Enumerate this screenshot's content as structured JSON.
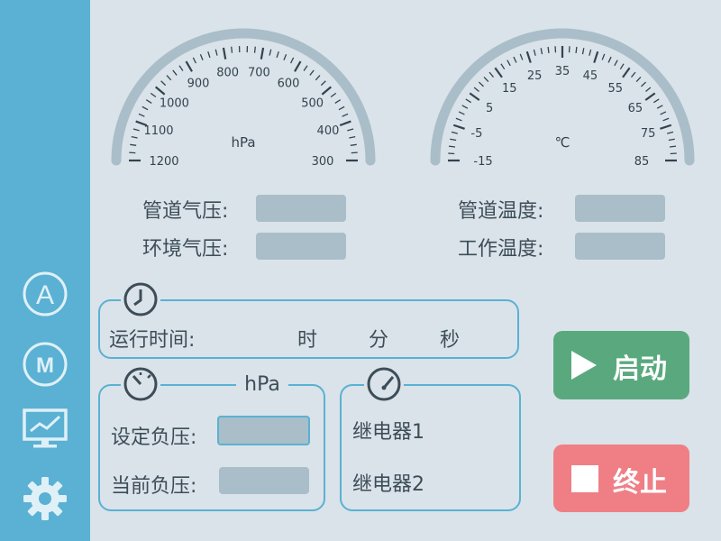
{
  "gauges": {
    "pressure": {
      "unit": "hPa",
      "ticks": [
        "1200",
        "1100",
        "1000",
        "900",
        "800",
        "700",
        "600",
        "500",
        "400",
        "300"
      ]
    },
    "temperature": {
      "unit": "℃",
      "ticks": [
        "-15",
        "-5",
        "5",
        "15",
        "25",
        "35",
        "45",
        "55",
        "65",
        "75",
        "85"
      ]
    }
  },
  "readouts": {
    "pipe_pressure": "管道气压:",
    "env_pressure": "环境气压:",
    "pipe_temp": "管道温度:",
    "work_temp": "工作温度:"
  },
  "runtime": {
    "label": "运行时间:",
    "hours": "时",
    "minutes": "分",
    "seconds": "秒"
  },
  "pressure_panel": {
    "unit": "hPa",
    "set_label": "设定负压:",
    "current_label": "当前负压:"
  },
  "relay_panel": {
    "relay1": "继电器1",
    "relay2": "继电器2"
  },
  "buttons": {
    "start": "启动",
    "stop": "终止"
  },
  "sidebar": {
    "auto_label": "A",
    "manual_label": "M"
  },
  "colors": {
    "sidebar": "#5ab1d3",
    "start_button": "#5aa97e",
    "stop_button": "#ef7f85",
    "gauge_arc": "#a9bec8",
    "input_box": "#a9bec8"
  }
}
